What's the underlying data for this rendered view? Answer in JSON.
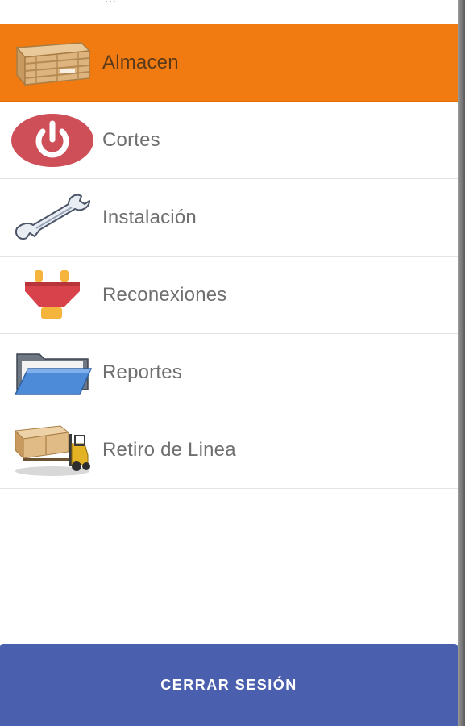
{
  "header": {
    "cut_text": "..."
  },
  "menu": {
    "items": [
      {
        "label": "Almacen",
        "icon": "warehouse-crate-icon",
        "active": true
      },
      {
        "label": "Cortes",
        "icon": "power-icon",
        "active": false
      },
      {
        "label": "Instalación",
        "icon": "wrench-icon",
        "active": false
      },
      {
        "label": "Reconexiones",
        "icon": "plug-icon",
        "active": false
      },
      {
        "label": "Reportes",
        "icon": "folder-icon",
        "active": false
      },
      {
        "label": "Retiro de Linea",
        "icon": "forklift-icon",
        "active": false
      }
    ]
  },
  "footer": {
    "logout_label": "CERRAR SESIÓN"
  },
  "colors": {
    "active_item": "#f17b10",
    "logout_button": "#4a5fae",
    "label_text": "#6f6f6f"
  }
}
